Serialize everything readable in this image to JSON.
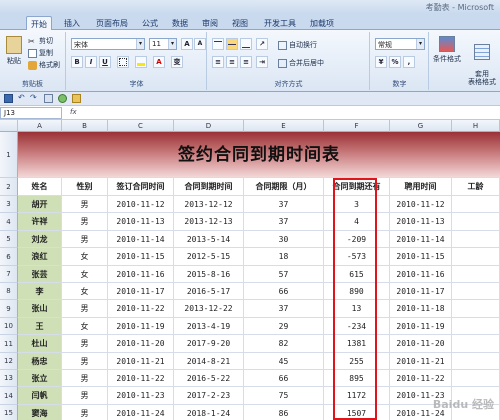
{
  "window": {
    "title": "考勤表 - Microsoft"
  },
  "ribbon_tabs": [
    "开始",
    "插入",
    "页面布局",
    "公式",
    "数据",
    "审阅",
    "视图",
    "开发工具",
    "加载项"
  ],
  "clipboard": {
    "paste": "粘贴",
    "cut": "剪切",
    "copy": "复制",
    "format_painter": "格式刷",
    "label": "剪贴板"
  },
  "font": {
    "name": "宋体",
    "size": "11",
    "bold": "B",
    "italic": "I",
    "underline": "U",
    "grow": "A",
    "shrink": "A",
    "color_a": "A",
    "wen": "变",
    "label": "字体"
  },
  "alignment": {
    "wrap": "自动换行",
    "merge": "合并后居中",
    "label": "对齐方式"
  },
  "number": {
    "format": "常规",
    "percent": "%",
    "comma": ",",
    "label": "数字"
  },
  "styles": {
    "conditional": "条件格式",
    "table": "套用\n表格格式"
  },
  "formula_bar": {
    "name_box": "J13",
    "fx": "fx"
  },
  "columns": [
    "A",
    "B",
    "C",
    "D",
    "E",
    "F",
    "G",
    "H"
  ],
  "row_numbers": [
    "1",
    "2",
    "3",
    "4",
    "5",
    "6",
    "7",
    "8",
    "9",
    "10",
    "11",
    "12",
    "13",
    "14",
    "15",
    "16"
  ],
  "sheet_title": "签约合同到期时间表",
  "headers": [
    "姓名",
    "性别",
    "签订合同时间",
    "合同到期时间",
    "合同期限（月）",
    "合同到期还有",
    "聘用时间",
    "工龄"
  ],
  "rows": [
    [
      "胡开",
      "男",
      "2010-11-12",
      "2013-12-12",
      "37",
      "3",
      "2010-11-12",
      ""
    ],
    [
      "许祥",
      "男",
      "2010-11-13",
      "2013-12-13",
      "37",
      "4",
      "2010-11-13",
      ""
    ],
    [
      "刘龙",
      "男",
      "2010-11-14",
      "2013-5-14",
      "30",
      "-209",
      "2010-11-14",
      ""
    ],
    [
      "浪红",
      "女",
      "2010-11-15",
      "2012-5-15",
      "18",
      "-573",
      "2010-11-15",
      ""
    ],
    [
      "张芸",
      "女",
      "2010-11-16",
      "2015-8-16",
      "57",
      "615",
      "2010-11-16",
      ""
    ],
    [
      "李",
      "女",
      "2010-11-17",
      "2016-5-17",
      "66",
      "890",
      "2010-11-17",
      ""
    ],
    [
      "张山",
      "男",
      "2010-11-22",
      "2013-12-22",
      "37",
      "13",
      "2010-11-18",
      ""
    ],
    [
      "王",
      "女",
      "2010-11-19",
      "2013-4-19",
      "29",
      "-234",
      "2010-11-19",
      ""
    ],
    [
      "杜山",
      "男",
      "2010-11-20",
      "2017-9-20",
      "82",
      "1381",
      "2010-11-20",
      ""
    ],
    [
      "杨忠",
      "男",
      "2010-11-21",
      "2014-8-21",
      "45",
      "255",
      "2010-11-21",
      ""
    ],
    [
      "张立",
      "男",
      "2010-11-22",
      "2016-5-22",
      "66",
      "895",
      "2010-11-22",
      ""
    ],
    [
      "闫帆",
      "男",
      "2010-11-23",
      "2017-2-23",
      "75",
      "1172",
      "2010-11-23",
      ""
    ],
    [
      "窦海",
      "男",
      "2010-11-24",
      "2018-1-24",
      "86",
      "1507",
      "2010-11-24",
      ""
    ],
    [
      "赵",
      "女",
      "2010-11-25",
      "2018-7-25",
      "92",
      "1689",
      "2010-11-25",
      ""
    ]
  ],
  "watermark": "Baidu 经验"
}
